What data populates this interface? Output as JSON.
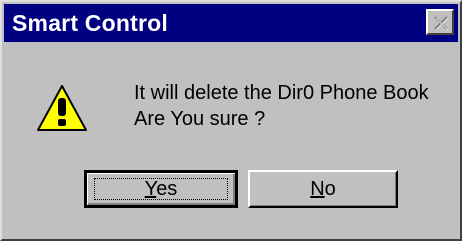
{
  "window": {
    "title": "Smart Control"
  },
  "icons": {
    "warning": "warning-icon",
    "close": "close-icon"
  },
  "message": {
    "line1": "It will delete the Dir0 Phone Book",
    "line2": "Are You sure ?"
  },
  "buttons": {
    "yes": {
      "accel": "Y",
      "rest": "es"
    },
    "no": {
      "accel": "N",
      "rest": "o"
    }
  },
  "colors": {
    "titlebar": "#000080",
    "face": "#c0c0c0",
    "warning_fill": "#ffff00"
  }
}
